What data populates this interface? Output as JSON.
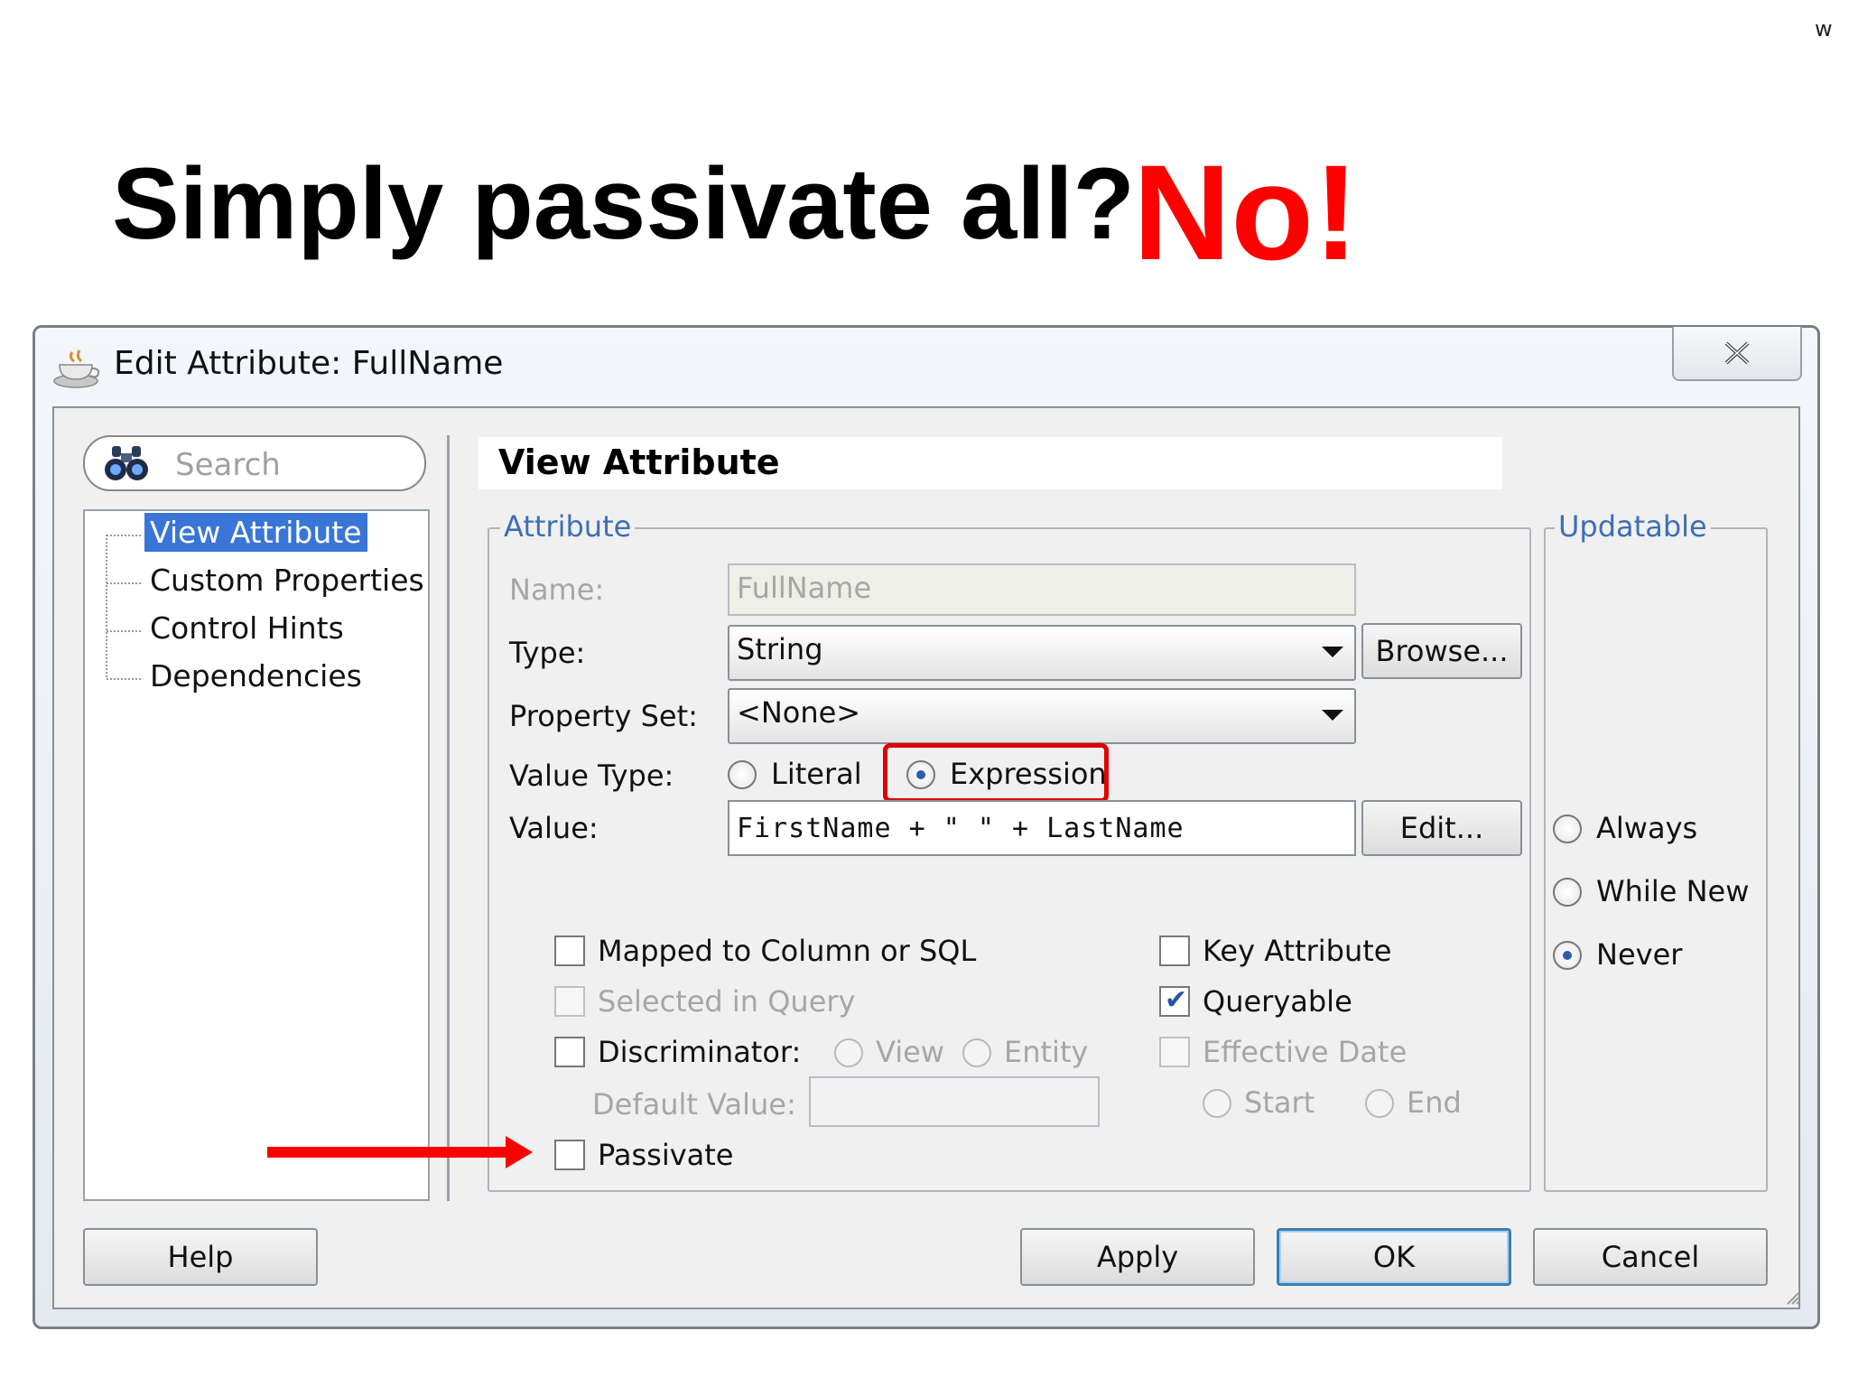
{
  "slide": {
    "corner_mark": "w",
    "title": "Simply passivate all?",
    "answer": "No!"
  },
  "dialog": {
    "title": "Edit Attribute: FullName",
    "close_icon": "close-icon",
    "search": {
      "placeholder": "Search",
      "icon": "binoculars-icon"
    },
    "nav": {
      "items": [
        {
          "label": "View Attribute",
          "selected": true
        },
        {
          "label": "Custom Properties",
          "selected": false
        },
        {
          "label": "Control Hints",
          "selected": false
        },
        {
          "label": "Dependencies",
          "selected": false
        }
      ]
    },
    "panel": {
      "title": "View Attribute",
      "attribute_group": {
        "legend": "Attribute",
        "name_label": "Name:",
        "name_value": "FullName",
        "type_label": "Type:",
        "type_value": "String",
        "browse_button": "Browse...",
        "property_set_label": "Property Set:",
        "property_set_value": "<None>",
        "value_type_label": "Value Type:",
        "value_type_options": [
          "Literal",
          "Expression"
        ],
        "value_type_selected": "Expression",
        "value_label": "Value:",
        "value_value": "FirstName + \" \" + LastName",
        "edit_button": "Edit...",
        "mapped_label": "Mapped to Column or SQL",
        "mapped_checked": false,
        "selected_in_query_label": "Selected in Query",
        "selected_in_query_checked": false,
        "discriminator_label": "Discriminator:",
        "discriminator_checked": false,
        "discriminator_options": [
          "View",
          "Entity"
        ],
        "default_value_label": "Default Value:",
        "default_value": "",
        "passivate_label": "Passivate",
        "passivate_checked": false,
        "key_attribute_label": "Key Attribute",
        "key_attribute_checked": false,
        "queryable_label": "Queryable",
        "queryable_checked": true,
        "effective_date_label": "Effective Date",
        "effective_date_checked": false,
        "effective_date_options": [
          "Start",
          "End"
        ]
      },
      "updatable_group": {
        "legend": "Updatable",
        "options": [
          "Always",
          "While New",
          "Never"
        ],
        "selected": "Never"
      }
    },
    "buttons": {
      "help": "Help",
      "apply": "Apply",
      "ok": "OK",
      "cancel": "Cancel"
    }
  },
  "colors": {
    "annotation_red": "#ff0000",
    "selection_blue": "#3875d7",
    "legend_blue": "#3c6fb4"
  }
}
